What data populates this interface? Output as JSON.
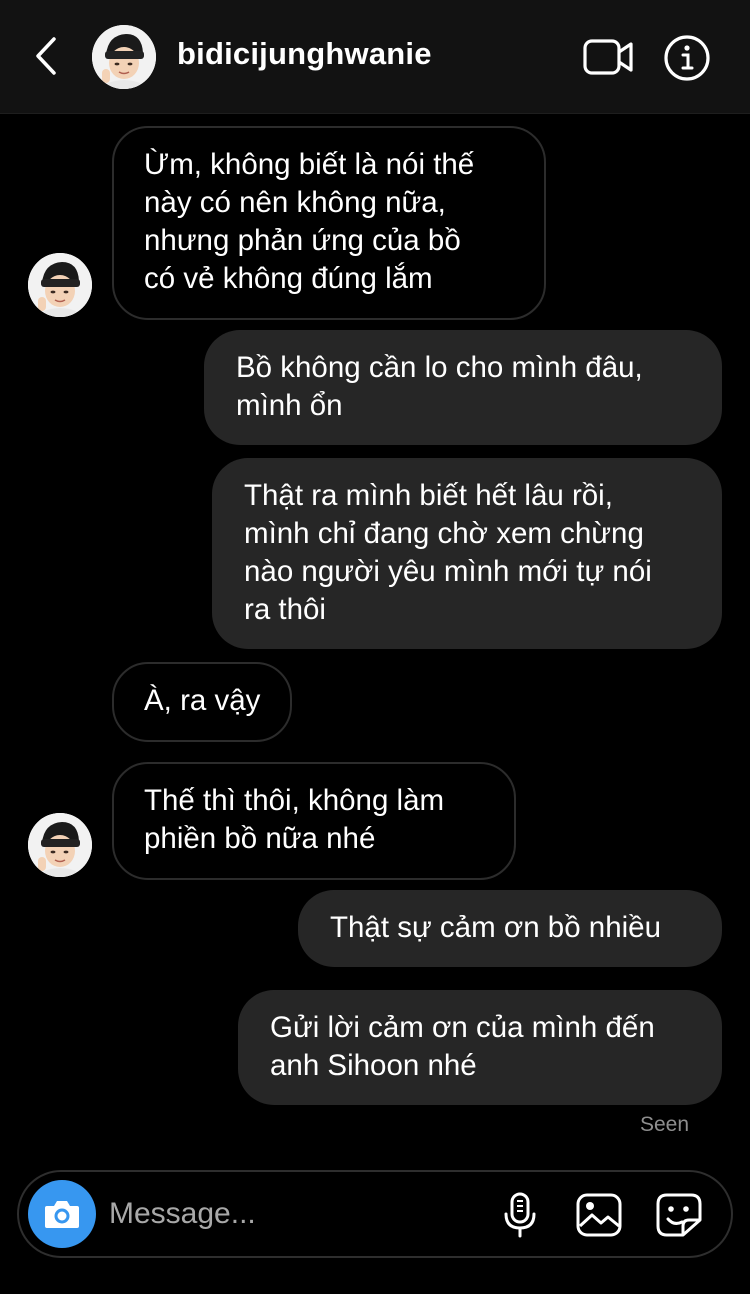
{
  "header": {
    "username": "bidicijunghwanie",
    "icons": {
      "back": "chevron-left-icon",
      "video": "video-call-icon",
      "info": "info-icon"
    }
  },
  "messages": [
    {
      "from": "them",
      "text": "Ừm, không biết là nói thế\nnày có nên không nữa,\nnhưng phản ứng của bồ\ncó vẻ không đúng lắm"
    },
    {
      "from": "me",
      "text": "Bồ không cần lo cho mình đâu,\nmình ổn"
    },
    {
      "from": "me",
      "text": "Thật ra mình biết hết lâu rồi,\nmình chỉ đang chờ xem chừng\nnào người yêu mình mới tự nói\nra thôi"
    },
    {
      "from": "them",
      "text": "À, ra vậy"
    },
    {
      "from": "them",
      "text": "Thế thì thôi, không làm\nphiền bồ nữa nhé"
    },
    {
      "from": "me",
      "text": "Thật sự cảm ơn bồ nhiều"
    },
    {
      "from": "me",
      "text": "Gửi lời cảm ơn của mình đến\nanh Sihoon nhé"
    }
  ],
  "status": {
    "seen": "Seen"
  },
  "composer": {
    "placeholder": "Message...",
    "accent": "#3797f0",
    "icons": {
      "camera": "camera-icon",
      "mic": "microphone-icon",
      "gallery": "gallery-icon",
      "sticker": "sticker-icon"
    }
  }
}
